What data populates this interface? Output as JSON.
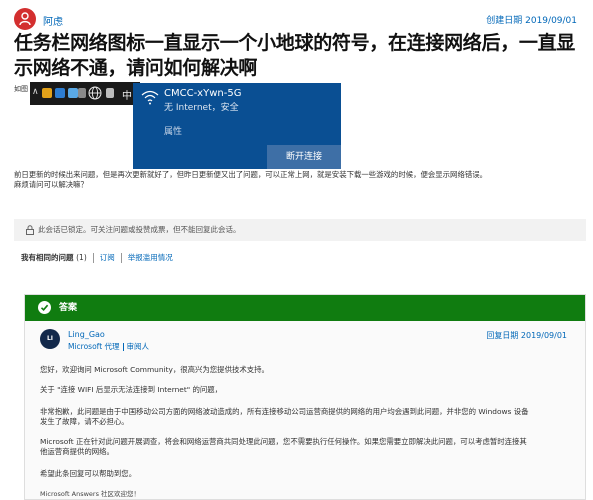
{
  "question": {
    "author": "阿虑",
    "created": "创建日期 2019/09/01",
    "title": "任务栏网络图标一直显示一个小地球的符号，在连接网络后，一直显示网络不通，请问如何解决啊",
    "screenshot_lead": "如图",
    "body_line1": "前日更新的时候出来问题，但是再次更新就好了，但昨日更新便又出了问题，可以正常上网，就是安装下载一些游戏的时候，便会显示网络错误。",
    "body_line2": "麻烦请问可以解决嘛？"
  },
  "taskbar": {
    "ime": "中",
    "icons": [
      "chevron-up-icon",
      "user-icon",
      "store-icon",
      "monitor-icon",
      "shield-icon",
      "globe-icon"
    ]
  },
  "network_flyout": {
    "ssid": "CMCC-xYwn-5G",
    "status": "无 Internet，安全",
    "properties": "属性",
    "disconnect": "断开连接"
  },
  "locked_notice": "此会话已锁定。可关注问题或投赞成票，但不能回复此会话。",
  "actions": {
    "same_question": "我有相同的问题",
    "same_count": "(1)",
    "subscribe": "订阅",
    "report": "举报滥用情况"
  },
  "answer": {
    "header": "答案",
    "avatar_initials": "LI",
    "responder": "Ling_Gao",
    "role": "Microsoft 代理",
    "role2": "审阅人",
    "replied": "回复日期 2019/09/01",
    "p1": "您好，欢迎询问 Microsoft Community，很高兴为您提供技术支持。",
    "p2": "关于 \"连接 WIFI 后显示无法连接到 Internet\" 的问题，",
    "p3a": "非常抱歉，此问题是由于中国移动公司方面的网络波动造成的，所有连接移动公司运营商提供的网络的用户均会遇到此问题，并非您的 Windows 设备",
    "p3b": "发生了故障，请不必担心。",
    "p4a": "Microsoft 正在针对此问题开展调查，将会和网络运营商共同处理此问题，您不需要执行任何操作。如果您需要立即解决此问题，可以考虑暂时连接其",
    "p4b": "他运营商提供的网络。",
    "p5": "希望此条回复可以帮助到您。",
    "signature": "Microsoft Answers 社区欢迎您！"
  },
  "colors": {
    "link": "#0067b8",
    "answer_green": "#107c10",
    "flyout_blue": "#0a4f93",
    "author_avatar": "#d32f2f"
  }
}
